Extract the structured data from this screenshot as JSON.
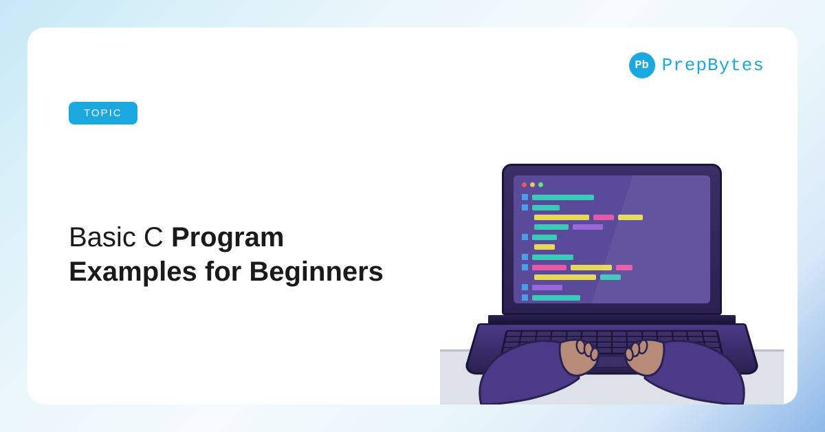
{
  "brand": {
    "logo_short": "Pb",
    "name": "PrepBytes"
  },
  "badge": {
    "label": "TOPIC"
  },
  "title": {
    "line1_light": "Basic C ",
    "line1_bold": "Program",
    "line2_bold": "Examples for Beginners"
  },
  "colors": {
    "accent": "#1ba8e0",
    "laptop_dark": "#2a2150",
    "laptop_mid": "#5a4a9a"
  }
}
